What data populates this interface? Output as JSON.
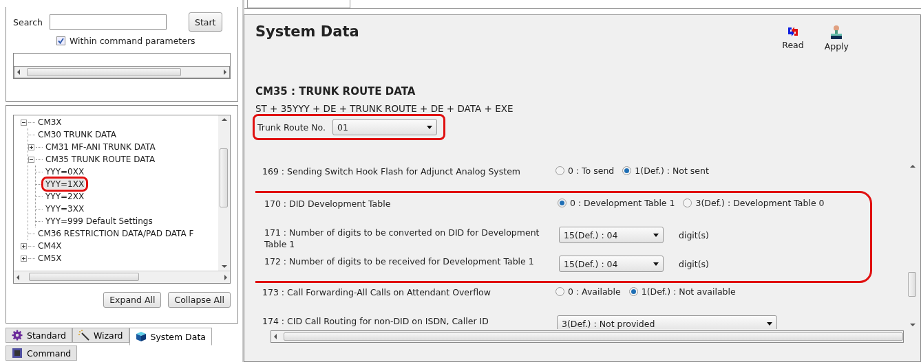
{
  "search": {
    "label": "Search",
    "button": "Start",
    "within_params": {
      "label": "Within command parameters",
      "checked": true
    }
  },
  "tree": {
    "items": [
      {
        "label": "CM3X",
        "expanded": true,
        "children": [
          {
            "label": "CM30 TRUNK DATA"
          },
          {
            "label": "CM31 MF-ANI TRUNK DATA",
            "expanded": false
          },
          {
            "label": "CM35 TRUNK ROUTE DATA",
            "expanded": true,
            "children": [
              {
                "label": "YYY=0XX",
                "selected": false,
                "highlighted": false
              },
              {
                "label": "YYY=1XX",
                "selected": true,
                "highlighted": true
              },
              {
                "label": "YYY=2XX",
                "selected": false,
                "highlighted": false
              },
              {
                "label": "YYY=3XX",
                "selected": false,
                "highlighted": false
              },
              {
                "label": "YYY=999 Default Settings",
                "selected": false,
                "highlighted": false
              }
            ]
          },
          {
            "label": "CM36 RESTRICTION DATA/PAD DATA F"
          }
        ]
      },
      {
        "label": "CM4X",
        "expanded": false
      },
      {
        "label": "CM5X",
        "expanded": false
      }
    ],
    "buttons": [
      "Expand All",
      "Collapse All"
    ]
  },
  "bottom_tabs": [
    {
      "label": "Standard",
      "selected": false
    },
    {
      "label": "Wizard",
      "selected": false
    },
    {
      "label": "System Data",
      "selected": true
    },
    {
      "label": "Command",
      "selected": false
    }
  ],
  "page": {
    "title": "System Data",
    "actions": [
      {
        "label": "Read"
      },
      {
        "label": "Apply"
      }
    ],
    "command_title": "CM35 : TRUNK ROUTE DATA",
    "command_syntax": "ST + 35YYY + DE + TRUNK ROUTE + DE + DATA + EXE",
    "trunk_route": {
      "label": "Trunk Route No.",
      "value": "01",
      "highlighted": true
    }
  },
  "parameters": [
    {
      "label": "169 : Sending Switch Hook Flash for Adjunct Analog System",
      "kind": "radio",
      "highlighted": false,
      "options": [
        {
          "label": "0 : To send",
          "selected": false
        },
        {
          "label": "1(Def.) : Not sent",
          "selected": true
        }
      ]
    },
    {
      "label": "170 : DID Development Table",
      "kind": "radio",
      "highlighted": true,
      "options": [
        {
          "label": "0 : Development Table 1",
          "selected": true
        },
        {
          "label": "3(Def.) : Development Table 0",
          "selected": false
        }
      ]
    },
    {
      "label": "171 : Number of digits to be converted on DID for Development Table 1",
      "kind": "select",
      "highlighted": true,
      "value": "15(Def.) : 04",
      "unit": "digit(s)"
    },
    {
      "label": "172 : Number of digits to be received for Development Table 1",
      "kind": "select",
      "highlighted": true,
      "value": "15(Def.) : 04",
      "unit": "digit(s)"
    },
    {
      "label": "173 : Call Forwarding-All Calls on Attendant Overflow",
      "kind": "radio",
      "highlighted": false,
      "options": [
        {
          "label": "0 : Available",
          "selected": false
        },
        {
          "label": "1(Def.) : Not available",
          "selected": true
        }
      ]
    },
    {
      "label": "174 : CID Call Routing for non-DID on ISDN, Caller ID",
      "kind": "wide-select",
      "highlighted": false,
      "value": "3(Def.) : Not provided"
    }
  ]
}
